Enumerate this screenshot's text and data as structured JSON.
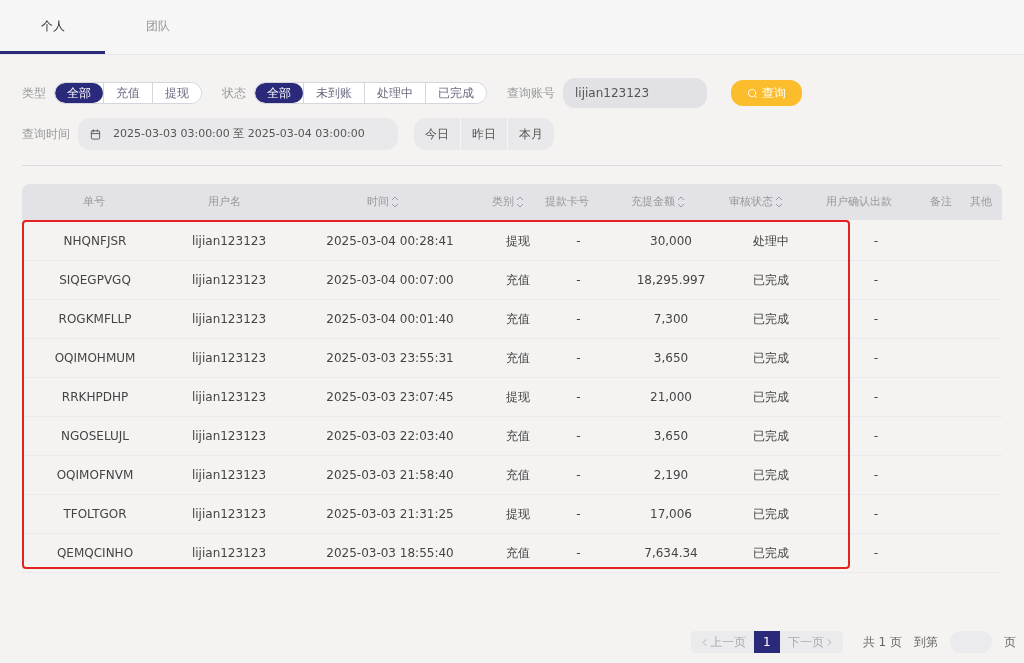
{
  "tabs": [
    {
      "label": "个人",
      "selected": true
    },
    {
      "label": "团队",
      "selected": false
    }
  ],
  "filters": {
    "type": {
      "label": "类型",
      "options": [
        {
          "label": "全部",
          "selected": true
        },
        {
          "label": "充值",
          "selected": false
        },
        {
          "label": "提现",
          "selected": false
        }
      ]
    },
    "status": {
      "label": "状态",
      "options": [
        {
          "label": "全部",
          "selected": true
        },
        {
          "label": "未到账",
          "selected": false
        },
        {
          "label": "处理中",
          "selected": false
        },
        {
          "label": "已完成",
          "selected": false
        }
      ]
    },
    "account": {
      "label": "查询账号",
      "value": "lijian123123"
    },
    "search_button": "查询",
    "time": {
      "label": "查询时间",
      "value": "2025-03-03 03:00:00 至 2025-03-04 03:00:00"
    },
    "quick_ranges": [
      "今日",
      "昨日",
      "本月"
    ]
  },
  "table": {
    "columns": [
      {
        "label": "单号",
        "sortable": false
      },
      {
        "label": "用户名",
        "sortable": false
      },
      {
        "label": "时间",
        "sortable": true
      },
      {
        "label": "类别",
        "sortable": true
      },
      {
        "label": "提款卡号",
        "sortable": false
      },
      {
        "label": "充提金额",
        "sortable": true
      },
      {
        "label": "审核状态",
        "sortable": true
      },
      {
        "label": "用户确认出款",
        "sortable": false
      },
      {
        "label": "备注",
        "sortable": false
      },
      {
        "label": "其他",
        "sortable": false
      }
    ],
    "rows": [
      [
        "NHQNFJSR",
        "lijian123123",
        "2025-03-04 00:28:41",
        "提现",
        "-",
        "30,000",
        "处理中",
        "-"
      ],
      [
        "SIQEGPVGQ",
        "lijian123123",
        "2025-03-04 00:07:00",
        "充值",
        "-",
        "18,295.997",
        "已完成",
        "-"
      ],
      [
        "ROGKMFLLP",
        "lijian123123",
        "2025-03-04 00:01:40",
        "充值",
        "-",
        "7,300",
        "已完成",
        "-"
      ],
      [
        "OQIMOHMUM",
        "lijian123123",
        "2025-03-03 23:55:31",
        "充值",
        "-",
        "3,650",
        "已完成",
        "-"
      ],
      [
        "RRKHPDHP",
        "lijian123123",
        "2025-03-03 23:07:45",
        "提现",
        "-",
        "21,000",
        "已完成",
        "-"
      ],
      [
        "NGOSELUJL",
        "lijian123123",
        "2025-03-03 22:03:40",
        "充值",
        "-",
        "3,650",
        "已完成",
        "-"
      ],
      [
        "OQIMOFNVM",
        "lijian123123",
        "2025-03-03 21:58:40",
        "充值",
        "-",
        "2,190",
        "已完成",
        "-"
      ],
      [
        "TFOLTGOR",
        "lijian123123",
        "2025-03-03 21:31:25",
        "提现",
        "-",
        "17,006",
        "已完成",
        "-"
      ],
      [
        "QEMQCINHO",
        "lijian123123",
        "2025-03-03 18:55:40",
        "充值",
        "-",
        "7,634.34",
        "已完成",
        "-"
      ]
    ]
  },
  "pagination": {
    "prev": "上一页",
    "pages": [
      {
        "label": "1",
        "selected": true
      }
    ],
    "next": "下一页",
    "total": "共 1 页",
    "goto": "到第",
    "goto_suffix": "页"
  }
}
